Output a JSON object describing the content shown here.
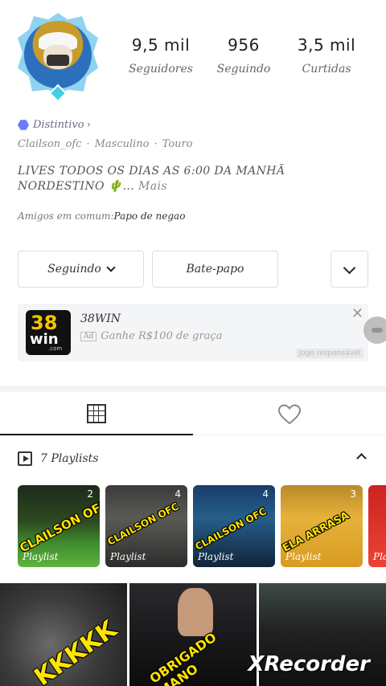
{
  "profile": {
    "stats": [
      {
        "value": "9,5 mil",
        "label": "Seguidores"
      },
      {
        "value": "956",
        "label": "Seguindo"
      },
      {
        "value": "3,5 mil",
        "label": "Curtidas"
      }
    ],
    "badge_label": "Distintivo",
    "username": "Clailson_ofc",
    "gender": "Masculino",
    "sign": "Touro",
    "bio_line1": "LIVES TODOS OS DIAS AS 6:00 DA MANHÃ",
    "bio_line2": "NORDESTINO 🌵...",
    "bio_more": "Mais",
    "friends_prefix": "Amigos em comum:",
    "friends_name": "Papo de negao"
  },
  "actions": {
    "follow_label": "Seguindo",
    "chat_label": "Bate-papo"
  },
  "ad": {
    "logo_number": "38",
    "logo_word": "win",
    "logo_domain": ".com",
    "title": "38WIN",
    "tag": "Ad",
    "subtitle": "Ganhe R$100 de graça",
    "responsible": "Jogo responsável"
  },
  "playlists": {
    "title": "7 Playlists",
    "items": [
      {
        "count": "2",
        "label": "Playlist",
        "stamp": "CLAILSON OFC"
      },
      {
        "count": "4",
        "label": "Playlist",
        "stamp": "CLAILSON OFC"
      },
      {
        "count": "4",
        "label": "Playlist",
        "stamp": "CLAILSON OFC"
      },
      {
        "count": "3",
        "label": "Playlist",
        "stamp": "ELA ARRASA"
      },
      {
        "count": "",
        "label": "Pla",
        "stamp": ""
      }
    ]
  },
  "videos": [
    {
      "stamp": "KKKKK"
    },
    {
      "stamp": "OBRIGADO MANO"
    },
    {
      "stamp": ""
    }
  ],
  "watermark": "XRecorder"
}
